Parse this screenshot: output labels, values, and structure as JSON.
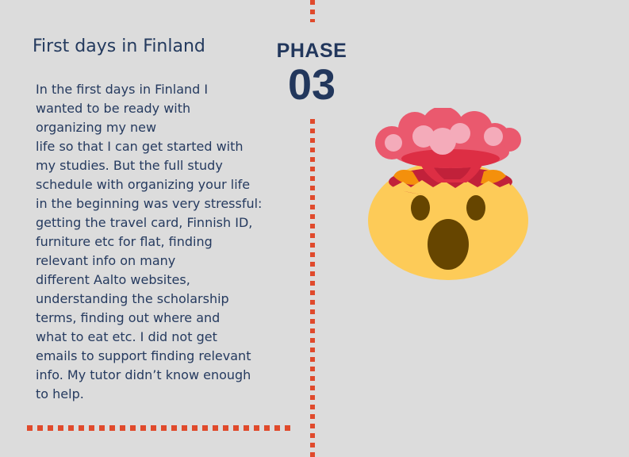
{
  "section": {
    "title": "First days in Finland",
    "body_lines": [
      "In the first days in Finland I",
      "wanted to be ready with",
      "organizing my new",
      "life so that I can get started with",
      "my studies. But the full study",
      "schedule with organizing your life",
      "in the beginning was very stressful:",
      "getting the travel card, Finnish ID,",
      "furniture etc for flat, finding",
      "relevant info on many",
      "different Aalto websites,",
      "understanding the scholarship",
      "terms, finding out where and",
      "what to eat etc. I did not get",
      "emails to support finding relevant",
      "info. My tutor didn’t know enough",
      "to help."
    ]
  },
  "phase": {
    "label": "PHASE",
    "number": "03"
  },
  "illustration": {
    "icon": "exploding-head-icon"
  },
  "colors": {
    "background": "#dcdcdc",
    "text": "#253a5f",
    "accent_dots": "#e04a2c",
    "emoji_face": "#fdcb58"
  }
}
